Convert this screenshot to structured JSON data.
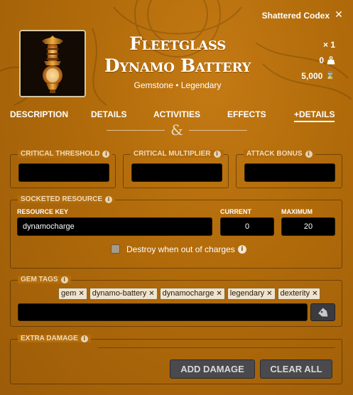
{
  "window": {
    "title": "Shattered Codex"
  },
  "item": {
    "name": "Fleetglass Dynamo Battery",
    "subtitle": "Gemstone • Legendary",
    "quantity": "× 1",
    "weight": "0",
    "price": "5,000"
  },
  "tabs": [
    {
      "label": "DESCRIPTION"
    },
    {
      "label": "DETAILS"
    },
    {
      "label": "ACTIVITIES"
    },
    {
      "label": "EFFECTS"
    },
    {
      "label": "+DETAILS"
    }
  ],
  "divider_mark": "&",
  "critical": {
    "threshold_label": "CRITICAL THRESHOLD",
    "threshold_value": "",
    "multiplier_label": "CRITICAL MULTIPLIER",
    "multiplier_value": "",
    "attack_label": "ATTACK BONUS",
    "attack_value": ""
  },
  "resource": {
    "legend": "SOCKETED RESOURCE",
    "key_label": "RESOURCE KEY",
    "key_value": "dynamocharge",
    "current_label": "CURRENT",
    "current_value": "0",
    "maximum_label": "MAXIMUM",
    "maximum_value": "20",
    "destroy_label": "Destroy when out of charges"
  },
  "gem_tags": {
    "legend": "GEM TAGS",
    "tags": [
      "gem",
      "dynamo-battery",
      "dynamocharge",
      "legendary",
      "dexterity"
    ],
    "input_value": ""
  },
  "extra_damage": {
    "legend": "EXTRA DAMAGE",
    "add_label": "ADD DAMAGE",
    "clear_label": "CLEAR ALL"
  },
  "icons": {
    "close": "close-icon",
    "info": "info-icon",
    "weight": "weight-icon",
    "price": "hourglass-icon",
    "tag": "tag-icon"
  }
}
